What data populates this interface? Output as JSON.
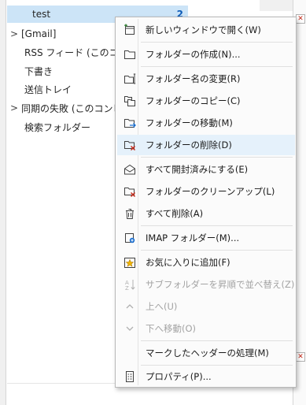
{
  "folders": [
    {
      "label": "test",
      "count": "2",
      "selected": true,
      "chevron": ""
    },
    {
      "label": "[Gmail]",
      "count": "",
      "selected": false,
      "chevron": ">"
    },
    {
      "label": "RSS フィード (このコンピ",
      "count": "",
      "selected": false,
      "chevron": ""
    },
    {
      "label": "下書き",
      "count": "",
      "selected": false,
      "chevron": ""
    },
    {
      "label": "送信トレイ",
      "count": "",
      "selected": false,
      "chevron": ""
    },
    {
      "label": "同期の失敗 (このコンピ",
      "count": "",
      "selected": false,
      "chevron": ">"
    },
    {
      "label": "検索フォルダー",
      "count": "",
      "selected": false,
      "chevron": ""
    }
  ],
  "menu": {
    "items": [
      {
        "label": "新しいウィンドウで開く(W)",
        "icon": "new-window-icon",
        "disabled": false
      },
      {
        "label": "フォルダーの作成(N)...",
        "icon": "new-folder-icon",
        "disabled": false
      },
      {
        "label": "フォルダー名の変更(R)",
        "icon": "rename-folder-icon",
        "disabled": false
      },
      {
        "label": "フォルダーのコピー(C)",
        "icon": "copy-folder-icon",
        "disabled": false
      },
      {
        "label": "フォルダーの移動(M)",
        "icon": "move-folder-icon",
        "disabled": false
      },
      {
        "label": "フォルダーの削除(D)",
        "icon": "delete-folder-icon",
        "disabled": false,
        "hover": true
      },
      {
        "label": "すべて開封済みにする(E)",
        "icon": "mark-read-icon",
        "disabled": false
      },
      {
        "label": "フォルダーのクリーンアップ(L)",
        "icon": "cleanup-folder-icon",
        "disabled": false
      },
      {
        "label": "すべて削除(A)",
        "icon": "delete-all-icon",
        "disabled": false
      },
      {
        "label": "IMAP フォルダー(M)...",
        "icon": "imap-folder-icon",
        "disabled": false
      },
      {
        "label": "お気に入りに追加(F)",
        "icon": "favorite-star-icon",
        "disabled": false
      },
      {
        "label": "サブフォルダーを昇順で並べ替え(Z)",
        "icon": "sort-az-icon",
        "disabled": true
      },
      {
        "label": "上へ(U)",
        "icon": "chevron-up-icon",
        "disabled": true
      },
      {
        "label": "下へ移動(O)",
        "icon": "chevron-down-icon",
        "disabled": true
      },
      {
        "label": "マークしたヘッダーの処理(M)",
        "icon": "",
        "disabled": false
      },
      {
        "label": "プロパティ(P)...",
        "icon": "properties-icon",
        "disabled": false
      }
    ]
  },
  "colors": {
    "selection": "#cce4f7",
    "menu_hover": "#e5f1fb",
    "accent": "#0e5cb8",
    "delete_red": "#c42b1c",
    "star_yellow": "#f2b600"
  }
}
